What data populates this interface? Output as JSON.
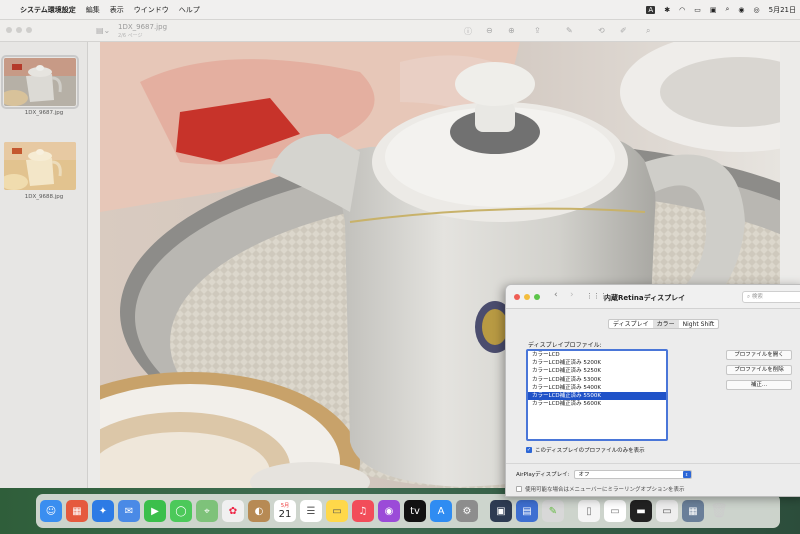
{
  "menubar": {
    "app_name": "システム環境設定",
    "items": [
      "編集",
      "表示",
      "ウインドウ",
      "ヘルプ"
    ],
    "input_indicator": "A",
    "clock": "5月21日"
  },
  "preview": {
    "title": "1DX_9687.jpg",
    "subtitle": "2/6 ページ",
    "thumbnails": [
      {
        "label": "1DX_9687.jpg"
      },
      {
        "label": "1DX_9688.jpg"
      }
    ]
  },
  "settings": {
    "title": "内蔵Retinaディスプレイ",
    "search_placeholder": "検索",
    "tabs": [
      "ディスプレイ",
      "カラー",
      "Night Shift"
    ],
    "active_tab": "カラー",
    "profile_label": "ディスプレイプロファイル:",
    "profiles": [
      "カラーLCD",
      "カラーLCD補正済み 5200K",
      "カラーLCD補正済み 5250K",
      "カラーLCD補正済み 5300K",
      "カラーLCD補正済み 5400K",
      "カラーLCD補正済み 5500K",
      "カラーLCD補正済み 5600K"
    ],
    "selected_profile": "カラーLCD補正済み 5500K",
    "buttons": {
      "open_profile": "プロファイルを開く",
      "delete_profile": "プロファイルを削除",
      "calibrate": "補正..."
    },
    "only_this_display": "このディスプレイのプロファイルのみを表示",
    "airplay_label": "AirPlayディスプレイ:",
    "airplay_value": "オフ",
    "mirroring_option": "使用可能な場合はメニューバーにミラーリングオプションを表示"
  },
  "dock": {
    "calendar_month": "5月",
    "calendar_day": "21"
  }
}
